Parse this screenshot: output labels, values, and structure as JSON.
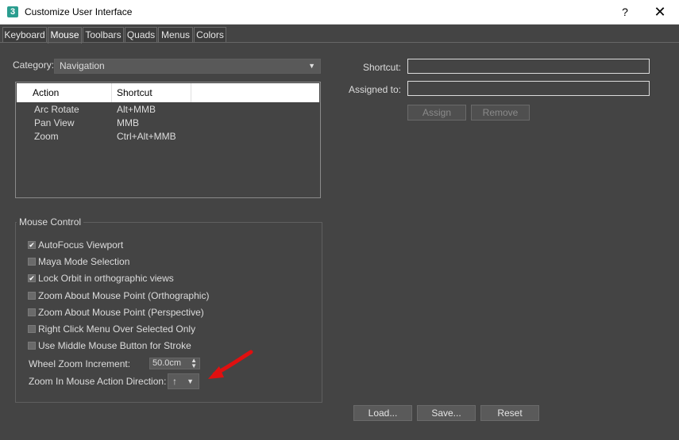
{
  "window": {
    "title": "Customize User Interface",
    "icon_glyph": "3",
    "help_label": "?",
    "close_label": "✕"
  },
  "tabs": [
    {
      "label": "Keyboard",
      "active": false
    },
    {
      "label": "Mouse",
      "active": true
    },
    {
      "label": "Toolbars",
      "active": false
    },
    {
      "label": "Quads",
      "active": false
    },
    {
      "label": "Menus",
      "active": false
    },
    {
      "label": "Colors",
      "active": false
    }
  ],
  "category": {
    "label": "Category:",
    "value": "Navigation"
  },
  "action_list": {
    "headers": [
      "Action",
      "Shortcut"
    ],
    "rows": [
      {
        "action": "Arc Rotate",
        "shortcut": "Alt+MMB"
      },
      {
        "action": "Pan View",
        "shortcut": "MMB"
      },
      {
        "action": "Zoom",
        "shortcut": "Ctrl+Alt+MMB"
      }
    ]
  },
  "mouse_control": {
    "title": "Mouse Control",
    "options": [
      {
        "label": "AutoFocus Viewport",
        "checked": true
      },
      {
        "label": "Maya Mode Selection",
        "checked": false
      },
      {
        "label": "Lock Orbit in orthographic views",
        "checked": true
      },
      {
        "label": "Zoom About Mouse Point (Orthographic)",
        "checked": false
      },
      {
        "label": "Zoom About Mouse Point (Perspective)",
        "checked": false
      },
      {
        "label": "Right Click Menu Over Selected Only",
        "checked": false
      },
      {
        "label": "Use Middle Mouse Button for Stroke",
        "checked": false
      }
    ],
    "wheel_zoom_label": "Wheel Zoom Increment:",
    "wheel_zoom_value": "50.0cm",
    "zoom_dir_label": "Zoom In Mouse Action Direction:",
    "zoom_dir_value": "↑"
  },
  "shortcut_panel": {
    "shortcut_label": "Shortcut:",
    "assigned_label": "Assigned to:",
    "assign_label": "Assign",
    "remove_label": "Remove"
  },
  "footer": {
    "load_label": "Load...",
    "save_label": "Save...",
    "reset_label": "Reset"
  },
  "colors": {
    "background": "#444444",
    "annotation_arrow": "#e01010"
  }
}
